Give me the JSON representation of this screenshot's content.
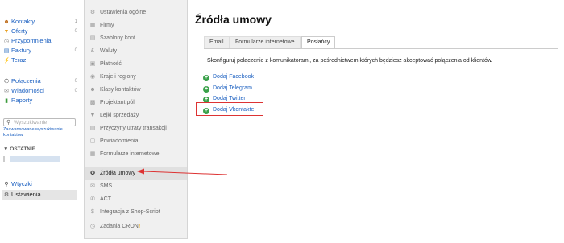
{
  "sidebar": {
    "items": [
      {
        "label": "Kontakty",
        "count": "1",
        "icon": "person-icon",
        "color": "#c07020"
      },
      {
        "label": "Oferty",
        "count": "0",
        "icon": "funnel-icon",
        "color": "#e8a020"
      },
      {
        "label": "Przypomnienia",
        "icon": "clock-icon",
        "color": "#888888"
      },
      {
        "label": "Faktury",
        "count": "0",
        "icon": "invoice-icon",
        "color": "#3070c0"
      },
      {
        "label": "Teraz",
        "icon": "lightning-icon",
        "color": "#e8b800"
      },
      {
        "label": "Połączenia",
        "count": "0",
        "icon": "phone-icon",
        "color": "#333333"
      },
      {
        "label": "Wiadomości",
        "count": "0",
        "icon": "envelope-icon",
        "color": "#888888"
      },
      {
        "label": "Raporty",
        "icon": "chart-icon",
        "color": "#3a9a3a"
      }
    ],
    "search_placeholder": "Wyszukiwanie",
    "advanced_search": "Zaawansowane wyszukiwanie kontaktów",
    "recent_heading": "▼ OSTATNIE",
    "bottom": [
      {
        "label": "Wtyczki",
        "icon": "plug-icon"
      },
      {
        "label": "Ustawienia",
        "icon": "gear-icon"
      }
    ]
  },
  "menu": {
    "items": [
      {
        "label": "Ustawienia ogólne",
        "icon": "gear-icon"
      },
      {
        "label": "Firmy",
        "icon": "building-icon"
      },
      {
        "label": "Szablony kont",
        "icon": "template-icon"
      },
      {
        "label": "Waluty",
        "icon": "currency-icon"
      },
      {
        "label": "Płatność",
        "icon": "payment-icon"
      },
      {
        "label": "Kraje i regiony",
        "icon": "globe-icon"
      },
      {
        "label": "Klasy kontaktów",
        "icon": "users-icon"
      },
      {
        "label": "Projektant pól",
        "icon": "fields-icon"
      },
      {
        "label": "Lejki sprzedaży",
        "icon": "funnel-icon"
      },
      {
        "label": "Przyczyny utraty transakcji",
        "icon": "lost-icon"
      },
      {
        "label": "Powiadomienia",
        "icon": "notification-icon"
      },
      {
        "label": "Formularze internetowe",
        "icon": "form-icon"
      },
      {
        "label": "Źródła umowy",
        "icon": "source-icon",
        "active": true
      },
      {
        "label": "SMS",
        "icon": "sms-icon"
      },
      {
        "label": "ACT",
        "icon": "phone-icon"
      },
      {
        "label": "Integracja z Shop-Script",
        "icon": "dollar-icon"
      },
      {
        "label": "Zadania CRON",
        "icon": "cron-icon",
        "star": "!"
      }
    ]
  },
  "main": {
    "title": "Źródła umowy",
    "tabs": [
      "Email",
      "Formularze internetowe",
      "Posłańcy"
    ],
    "active_tab": 2,
    "description": "Skonfiguruj połączenie z komunikatorami, za pośrednictwem których będziesz akceptować połączenia od klientów.",
    "links": [
      "Dodaj Facebook",
      "Dodaj Telegram",
      "Dodaj Twitter",
      "Dodaj Vkontakte"
    ]
  },
  "annotation_color": "#dd3333"
}
